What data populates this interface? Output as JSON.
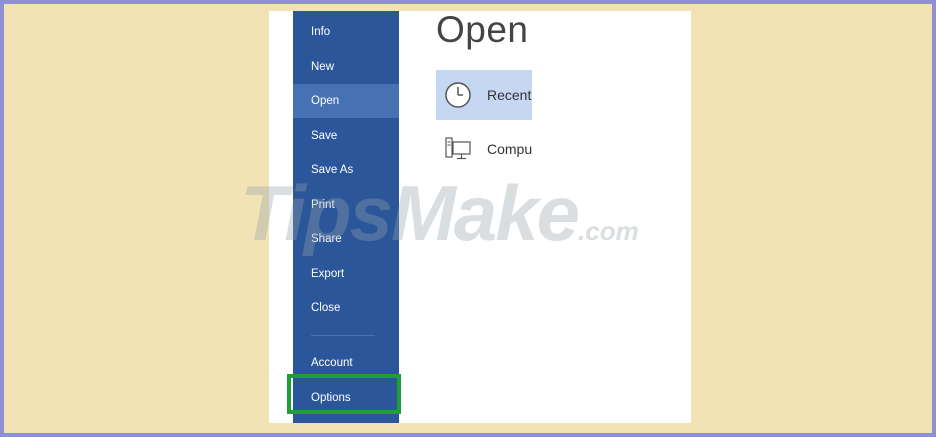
{
  "backstage": {
    "nav": [
      {
        "label": "Info"
      },
      {
        "label": "New"
      },
      {
        "label": "Open"
      },
      {
        "label": "Save"
      },
      {
        "label": "Save As"
      },
      {
        "label": "Print"
      },
      {
        "label": "Share"
      },
      {
        "label": "Export"
      },
      {
        "label": "Close"
      },
      {
        "label": "Account"
      },
      {
        "label": "Options"
      }
    ],
    "active_item": "Open",
    "highlighted_item": "Options"
  },
  "main": {
    "title": "Open",
    "locations": [
      {
        "label": "Recent",
        "icon": "clock-icon"
      },
      {
        "label": "Compu",
        "icon": "computer-icon"
      }
    ]
  },
  "watermark": {
    "brand": "TipsMake",
    "suffix": ".com"
  },
  "colors": {
    "sidebar": "#2b579a",
    "sidebar_active": "#4672b3",
    "location_active": "#c5d7f1",
    "highlight_border": "#1f9e3a",
    "outer_border": "#8f8fd6",
    "background": "#f1e3b4"
  }
}
